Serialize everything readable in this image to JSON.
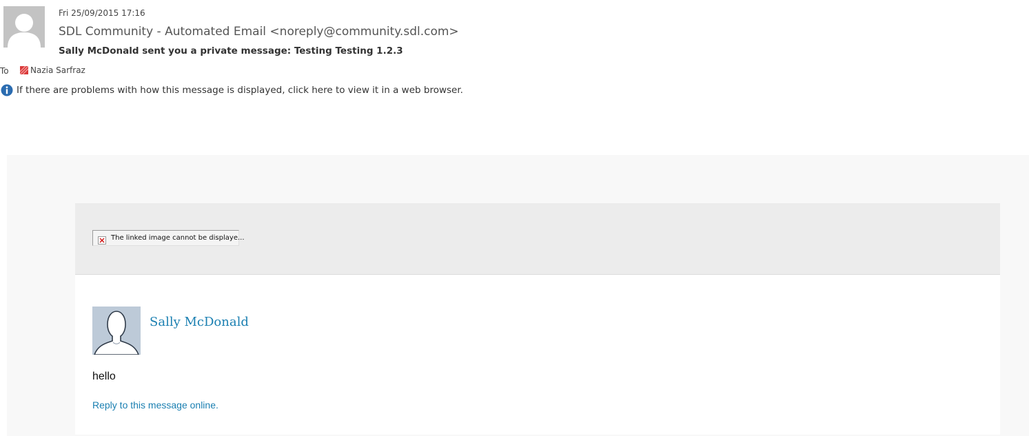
{
  "header": {
    "sent_date": "Fri 25/09/2015 17:16",
    "sender": "SDL Community - Automated Email <noreply@community.sdl.com>",
    "subject": "Sally McDonald sent you a private message: Testing Testing 1.2.3",
    "to_label": "To",
    "recipient": "Nazia Sarfraz",
    "info_message": "If there are problems with how this message is displayed, click here to view it in a web browser."
  },
  "body": {
    "broken_image_alt": "The linked image cannot be displaye...",
    "author_name": "Sally McDonald",
    "message": "hello",
    "reply_link": "Reply to this message online."
  },
  "colors": {
    "link": "#1a7fb1",
    "info_icon": "#2b6cb0",
    "presence": "#d93a3a"
  },
  "icons": [
    "person-silhouette-icon",
    "presence-status-icon",
    "info-icon",
    "broken-image-icon"
  ]
}
